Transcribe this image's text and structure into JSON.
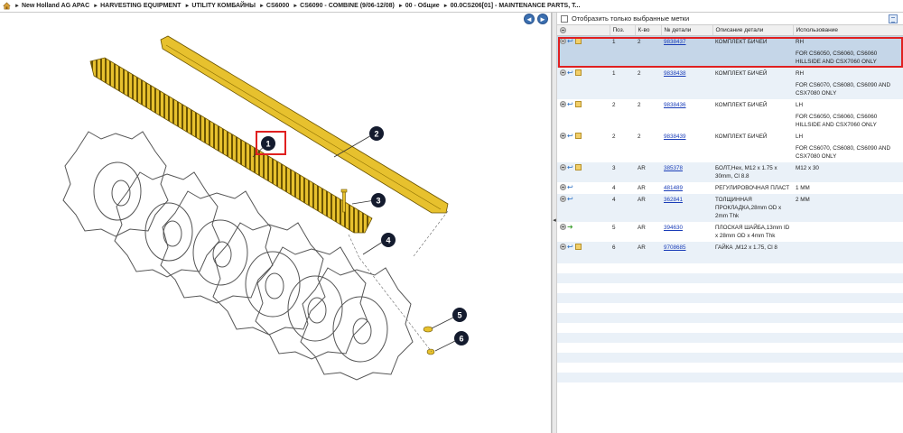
{
  "breadcrumb": [
    "New Holland AG APAC",
    "HARVESTING EQUIPMENT",
    "UTILITY КОМБАЙНЫ",
    "CS6000",
    "CS6090 - COMBINE (9/06-12/08)",
    "00 - Общие",
    "00.0CS206[01] - MAINTENANCE PARTS, T..."
  ],
  "drawing": {
    "callouts": [
      "1",
      "2",
      "3",
      "4",
      "5",
      "6"
    ],
    "nav_prev": "◄",
    "nav_next": "►"
  },
  "filter": {
    "label": "Отобразить только выбранные метки"
  },
  "table": {
    "headers": [
      "",
      "Поз.",
      "К-во",
      "№ детали",
      "Описание детали",
      "Использование"
    ],
    "rows": [
      {
        "pos": "1",
        "qty": "2",
        "part": "9838437",
        "desc": "КОМПЛЕКТ БИЧЕЙ",
        "usage": "RH",
        "icons": [
          "plus",
          "swap",
          "box"
        ],
        "style": "selected"
      },
      {
        "pos": "",
        "qty": "",
        "part": "",
        "desc": "",
        "usage": "FOR CS6050, CS6060, CS6060 HILLSIDE AND CSX7060 ONLY",
        "icons": [],
        "style": "selected"
      },
      {
        "pos": "1",
        "qty": "2",
        "part": "9838438",
        "desc": "КОМПЛЕКТ БИЧЕЙ",
        "usage": "RH",
        "icons": [
          "plus",
          "swap",
          "box"
        ],
        "style": "row-b"
      },
      {
        "pos": "",
        "qty": "",
        "part": "",
        "desc": "",
        "usage": "FOR CS6070, CS6080, CS6090 AND CSX7080 ONLY",
        "icons": [],
        "style": "row-b"
      },
      {
        "pos": "2",
        "qty": "2",
        "part": "9838436",
        "desc": "КОМПЛЕКТ БИЧЕЙ",
        "usage": "LH",
        "icons": [
          "plus",
          "swap",
          "box"
        ],
        "style": "row-a"
      },
      {
        "pos": "",
        "qty": "",
        "part": "",
        "desc": "",
        "usage": "FOR CS6050, CS6060, CS6060 HILLSIDE AND CSX7060 ONLY",
        "icons": [],
        "style": "row-a"
      },
      {
        "pos": "2",
        "qty": "2",
        "part": "9838439",
        "desc": "КОМПЛЕКТ БИЧЕЙ",
        "usage": "LH",
        "icons": [
          "plus",
          "swap",
          "box"
        ],
        "style": "row-a"
      },
      {
        "pos": "",
        "qty": "",
        "part": "",
        "desc": "",
        "usage": "FOR CS6070, CS6080, CS6090 AND CSX7080 ONLY",
        "icons": [],
        "style": "row-a"
      },
      {
        "pos": "3",
        "qty": "AR",
        "part": "385378",
        "desc": "БОЛТ,Hex, M12 x 1.75 x 30mm, Cl 8.8",
        "usage": "M12 x 30",
        "icons": [
          "plus",
          "swap",
          "box"
        ],
        "style": "row-b"
      },
      {
        "pos": "4",
        "qty": "AR",
        "part": "481489",
        "desc": "РЕГУЛИРОВОЧНАЯ ПЛАСТ",
        "usage": "1 MM",
        "icons": [
          "plus",
          "swap"
        ],
        "style": "row-a"
      },
      {
        "pos": "4",
        "qty": "AR",
        "part": "362841",
        "desc": "ТОЛЩИННАЯ ПРОКЛАДКА,28mm OD x 2mm Thk",
        "usage": "2 MM",
        "icons": [
          "plus",
          "swap"
        ],
        "style": "row-b"
      },
      {
        "pos": "5",
        "qty": "AR",
        "part": "394630",
        "desc": "ПЛОСКАЯ ШАЙБА,13mm ID x 28mm OD x 4mm Thk",
        "usage": "",
        "icons": [
          "plus",
          "green"
        ],
        "style": "row-a"
      },
      {
        "pos": "6",
        "qty": "AR",
        "part": "9708685",
        "desc": "ГАЙКА ,M12 x 1.75, Cl 8",
        "usage": "",
        "icons": [
          "plus",
          "swap",
          "box"
        ],
        "style": "row-b"
      }
    ]
  }
}
